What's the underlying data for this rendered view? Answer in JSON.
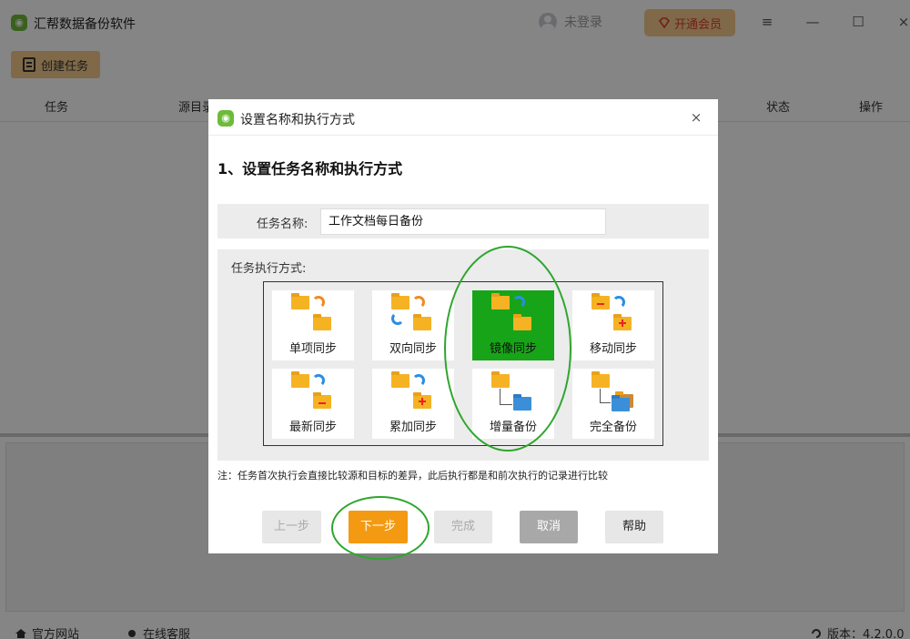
{
  "app": {
    "title": "汇帮数据备份软件",
    "user_label": "未登录",
    "vip_label": "开通会员",
    "menu_icon": "≡",
    "minimize_icon": "—",
    "maximize_icon": "☐",
    "close_icon": "×"
  },
  "toolbar": {
    "create_label": "创建任务"
  },
  "table": {
    "columns": [
      "任务",
      "源目录",
      "状态",
      "操作"
    ]
  },
  "statusbar": {
    "website": "官方网站",
    "support": "在线客服",
    "version": "版本：4.2.0.0"
  },
  "dialog": {
    "title": "设置名称和执行方式",
    "close_icon": "×",
    "step_title": "1、设置任务名称和执行方式",
    "name_label": "任务名称:",
    "name_value": "工作文档每日备份",
    "mode_label": "任务执行方式:",
    "modes": [
      {
        "label": "单项同步",
        "selected": false
      },
      {
        "label": "双向同步",
        "selected": false
      },
      {
        "label": "镜像同步",
        "selected": true
      },
      {
        "label": "移动同步",
        "selected": false
      },
      {
        "label": "最新同步",
        "selected": false
      },
      {
        "label": "累加同步",
        "selected": false
      },
      {
        "label": "增量备份",
        "selected": false
      },
      {
        "label": "完全备份",
        "selected": false
      }
    ],
    "note": "注：任务首次执行会直接比较源和目标的差异，此后执行都是和前次执行的记录进行比较",
    "buttons": {
      "prev": "上一步",
      "next": "下一步",
      "finish": "完成",
      "cancel": "取消",
      "help": "帮助"
    }
  },
  "colors": {
    "accent_orange": "#f39a12",
    "vip_bg": "#f4c98b",
    "selected_green": "#18a418",
    "annotation_green": "#2ea62e"
  }
}
